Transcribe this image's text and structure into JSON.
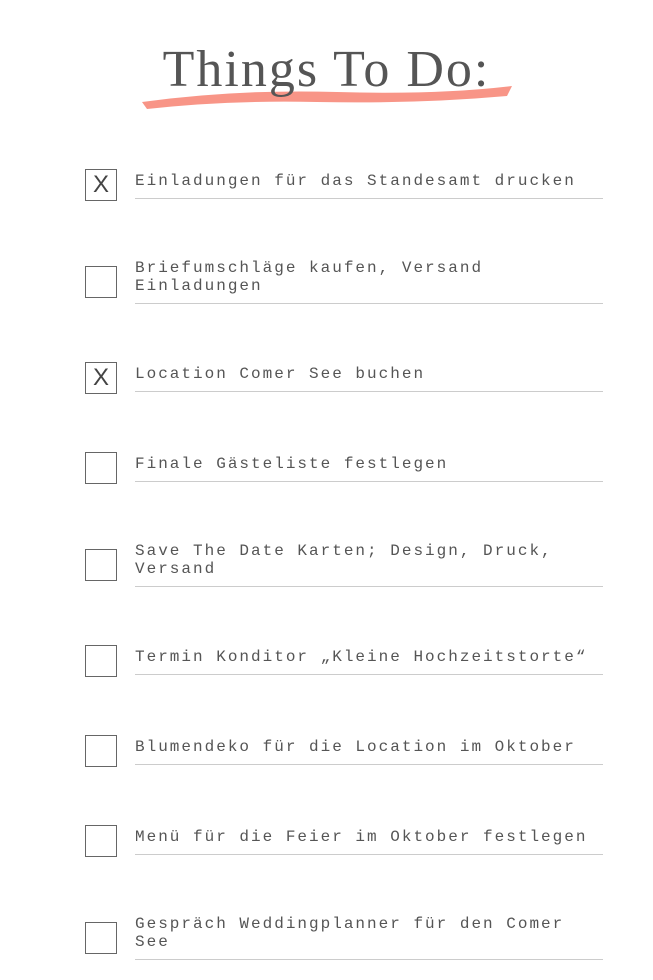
{
  "title": "Things To Do:",
  "checkmark": "X",
  "items": [
    {
      "text": "Einladungen für das Standesamt drucken",
      "checked": true
    },
    {
      "text": "Briefumschläge kaufen, Versand Einladungen",
      "checked": false
    },
    {
      "text": "Location Comer See buchen",
      "checked": true
    },
    {
      "text": "Finale Gästeliste festlegen",
      "checked": false
    },
    {
      "text": "Save The Date Karten; Design, Druck, Versand",
      "checked": false
    },
    {
      "text": "Termin Konditor „Kleine Hochzeitstorte“",
      "checked": false
    },
    {
      "text": "Blumendeko für die Location im Oktober",
      "checked": false
    },
    {
      "text": "Menü für die Feier im Oktober festlegen",
      "checked": false
    },
    {
      "text": "Gespräch Weddingplanner für den Comer See",
      "checked": false
    }
  ]
}
